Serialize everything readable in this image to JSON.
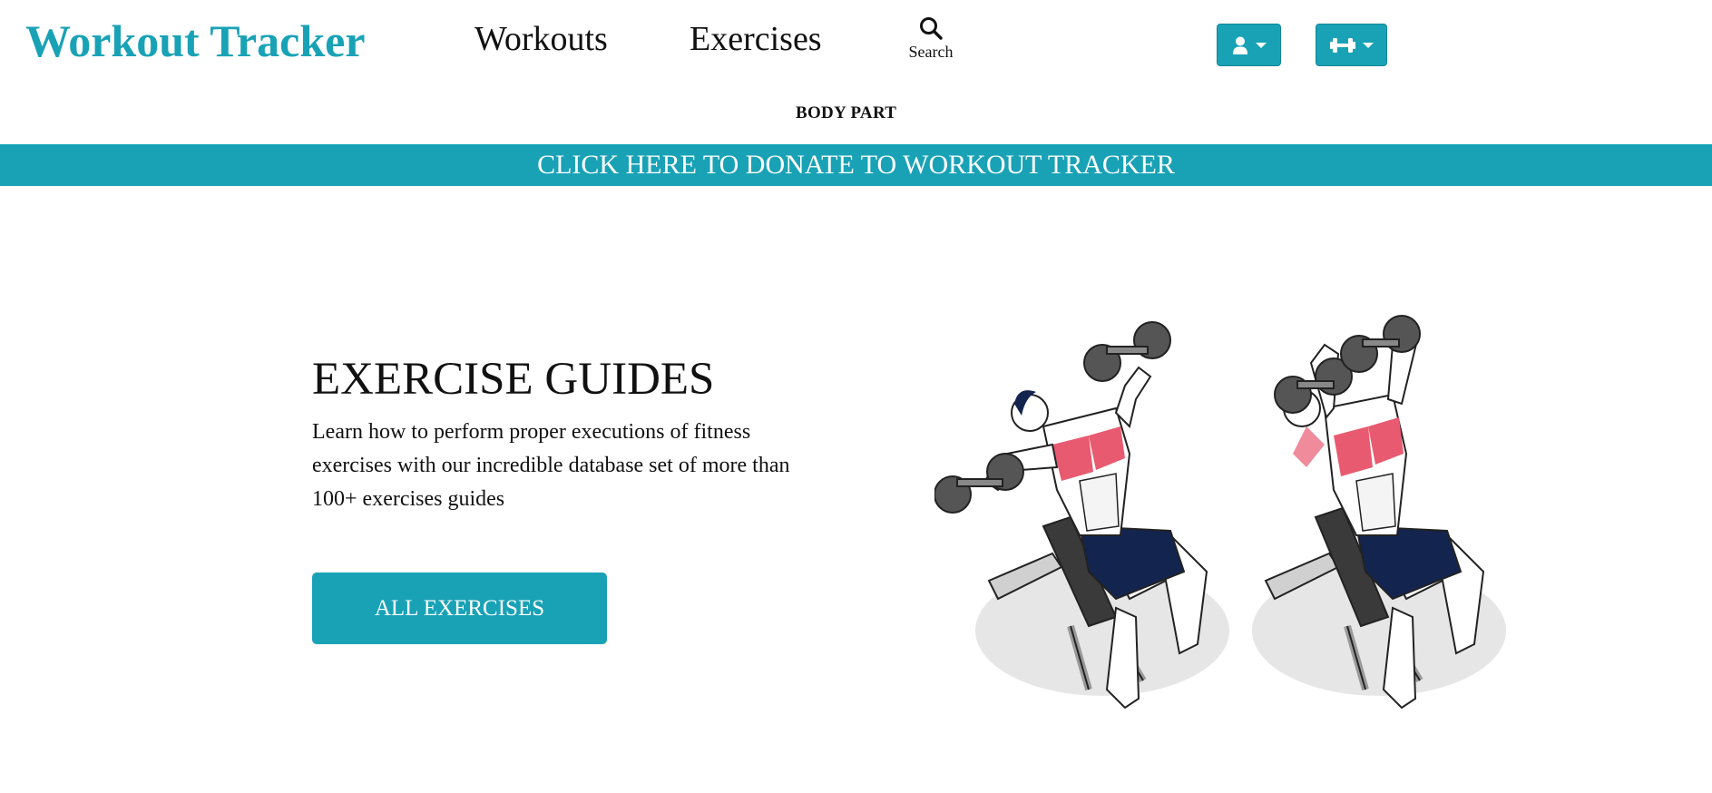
{
  "header": {
    "brand": "Workout Tracker",
    "nav": [
      {
        "label": "Workouts"
      },
      {
        "label": "Exercises"
      }
    ],
    "search_label": "Search",
    "user_menu_icon": "user-icon",
    "workout_menu_icon": "dumbbell-icon",
    "subnav_label": "BODY PART"
  },
  "banner": {
    "donate_label": "CLICK HERE TO DONATE TO WORKOUT TRACKER"
  },
  "hero": {
    "title": "EXERCISE GUIDES",
    "description": "Learn how to perform proper executions of fitness exercises with our incredible database set of more than 100+ exercises guides",
    "cta_label": "ALL EXERCISES"
  },
  "colors": {
    "accent": "#19a2b6",
    "muscle_highlight": "#e85a70",
    "shorts": "#13254f"
  }
}
